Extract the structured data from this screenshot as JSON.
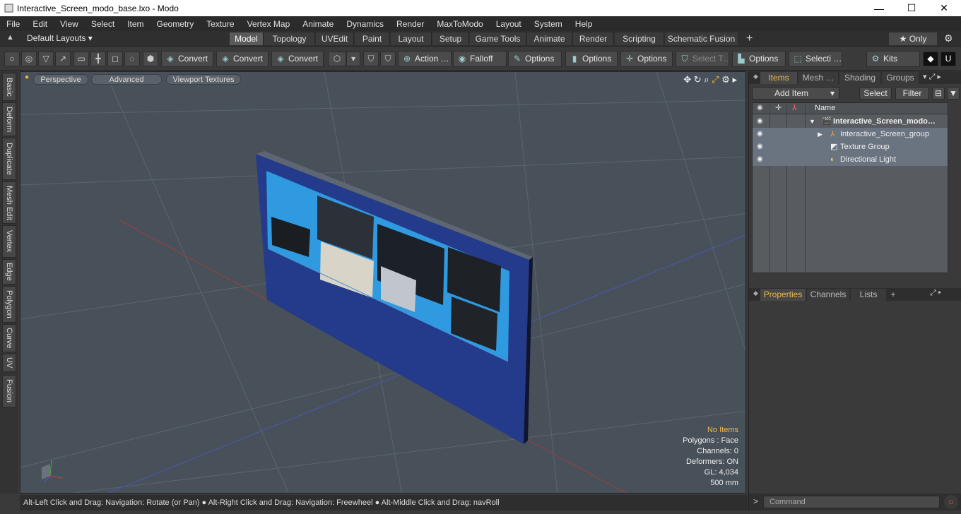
{
  "window": {
    "title": "Interactive_Screen_modo_base.lxo - Modo",
    "minimize": "—",
    "maximize": "☐",
    "close": "✕"
  },
  "menu": [
    "File",
    "Edit",
    "View",
    "Select",
    "Item",
    "Geometry",
    "Texture",
    "Vertex Map",
    "Animate",
    "Dynamics",
    "Render",
    "MaxToModo",
    "Layout",
    "System",
    "Help"
  ],
  "layouts": {
    "label": "Default Layouts ▾"
  },
  "mode_tabs": [
    "Model",
    "Topology",
    "UVEdit",
    "Paint",
    "Layout",
    "Setup",
    "Game Tools",
    "Animate",
    "Render",
    "Scripting",
    "Schematic Fusion",
    "+"
  ],
  "only_button": "★ Only",
  "toolbar": {
    "convert1": "Convert",
    "convert2": "Convert",
    "convert3": "Convert",
    "action": "Action …",
    "falloff": "Falloff",
    "options1": "Options",
    "options2": "Options",
    "options3": "Options",
    "select_t": "Select T…",
    "options4": "Options",
    "selecti": "Selecti …",
    "kits": "Kits"
  },
  "left_tabs": [
    "Basic",
    "Deform",
    "Duplicate",
    "Mesh Edit",
    "Vertex",
    "Edge",
    "Polygon",
    "Curve",
    "UV",
    "Fusion"
  ],
  "viewport": {
    "perspective": "Perspective",
    "advanced": "Advanced",
    "textures": "Viewport Textures",
    "info": {
      "no_items": "No Items",
      "polygons": "Polygons : Face",
      "channels": "Channels: 0",
      "deformers": "Deformers: ON",
      "gl": "GL: 4,034",
      "scale": "500 mm"
    }
  },
  "status": "Alt-Left Click and Drag: Navigation: Rotate (or Pan) ● Alt-Right Click and Drag: Navigation: Freewheel ● Alt-Middle Click and Drag: navRoll",
  "items_panel": {
    "tabs": [
      "Items",
      "Mesh …",
      "Shading",
      "Groups"
    ],
    "add_item": "Add Item",
    "select": "Select",
    "filter": "Filter",
    "name_col": "Name",
    "rows": [
      "Interactive_Screen_modo…",
      "Interactive_Screen_group",
      "Texture Group",
      "Directional Light"
    ]
  },
  "props_panel": {
    "tabs": [
      "Properties",
      "Channels",
      "Lists",
      "+"
    ]
  },
  "command": {
    "placeholder": "Command"
  },
  "colors": {
    "accent": "#f2b84b",
    "viewport_bg": "#48515a",
    "screen_panel": "#223a8c",
    "screen_blue": "#2f9ae0"
  }
}
